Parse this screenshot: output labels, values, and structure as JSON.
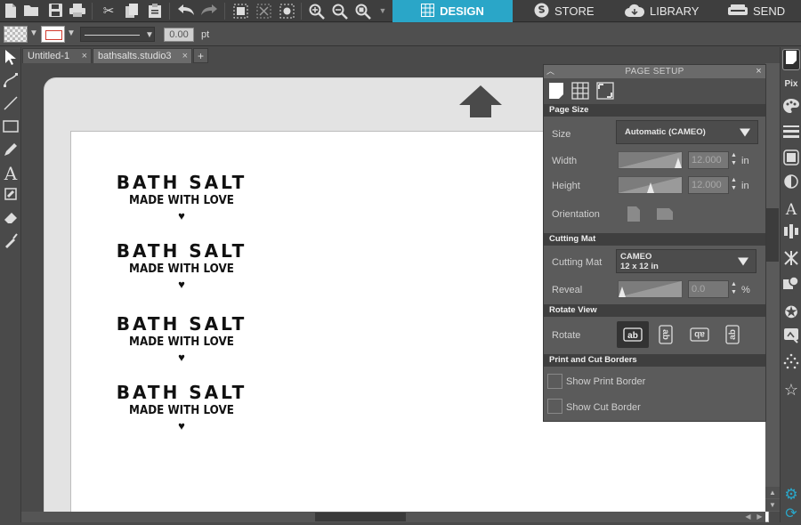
{
  "toolbar": {
    "icons": [
      "new-document",
      "open-folder",
      "save",
      "print",
      "cut",
      "copy",
      "paste",
      "undo",
      "redo",
      "group",
      "ungroup",
      "select-all",
      "zoom-in",
      "zoom-out",
      "zoom-fit"
    ]
  },
  "nav_tabs": {
    "design": "DESIGN",
    "store": "STORE",
    "library": "LIBRARY",
    "send": "SEND"
  },
  "line_options": {
    "width_value": "0.00",
    "unit": "pt"
  },
  "doc_tabs": [
    {
      "label": "Untitled-1",
      "close": "×"
    },
    {
      "label": "bathsalts.studio3",
      "close": "×"
    }
  ],
  "add_tab": "+",
  "labels": [
    {
      "title": "BATH SALT",
      "subtitle": "MADE WITH LOVE",
      "heart": "♥"
    },
    {
      "title": "BATH SALT",
      "subtitle": "MADE WITH LOVE",
      "heart": "♥"
    },
    {
      "title": "BATH SALT",
      "subtitle": "MADE WITH LOVE",
      "heart": "♥"
    },
    {
      "title": "BATH SALT",
      "subtitle": "MADE WITH LOVE",
      "heart": "♥"
    }
  ],
  "panel": {
    "title": "PAGE SETUP",
    "close": "×",
    "page_size": {
      "heading": "Page Size",
      "size_label": "Size",
      "size_value": "Automatic (CAMEO)",
      "width_label": "Width",
      "width_value": "12.000",
      "width_unit": "in",
      "height_label": "Height",
      "height_value": "12.000",
      "height_unit": "in",
      "orientation_label": "Orientation"
    },
    "cutting_mat": {
      "heading": "Cutting Mat",
      "mat_label": "Cutting Mat",
      "mat_line1": "CAMEO",
      "mat_line2": "12 x 12 in",
      "reveal_label": "Reveal",
      "reveal_value": "0.0",
      "reveal_unit": "%"
    },
    "rotate_view": {
      "heading": "Rotate View",
      "rotate_label": "Rotate",
      "options": [
        "ab",
        "ab",
        "ab",
        "ab"
      ]
    },
    "borders": {
      "heading": "Print and Cut Borders",
      "show_print_border": "Show Print Border",
      "show_cut_border": "Show Cut Border"
    }
  },
  "colors": {
    "accent": "#2aa6c8",
    "toolbar_bg": "#3e3e3e",
    "panel_bg": "#5b5b5b",
    "stroke_color": "#d23b2e"
  }
}
